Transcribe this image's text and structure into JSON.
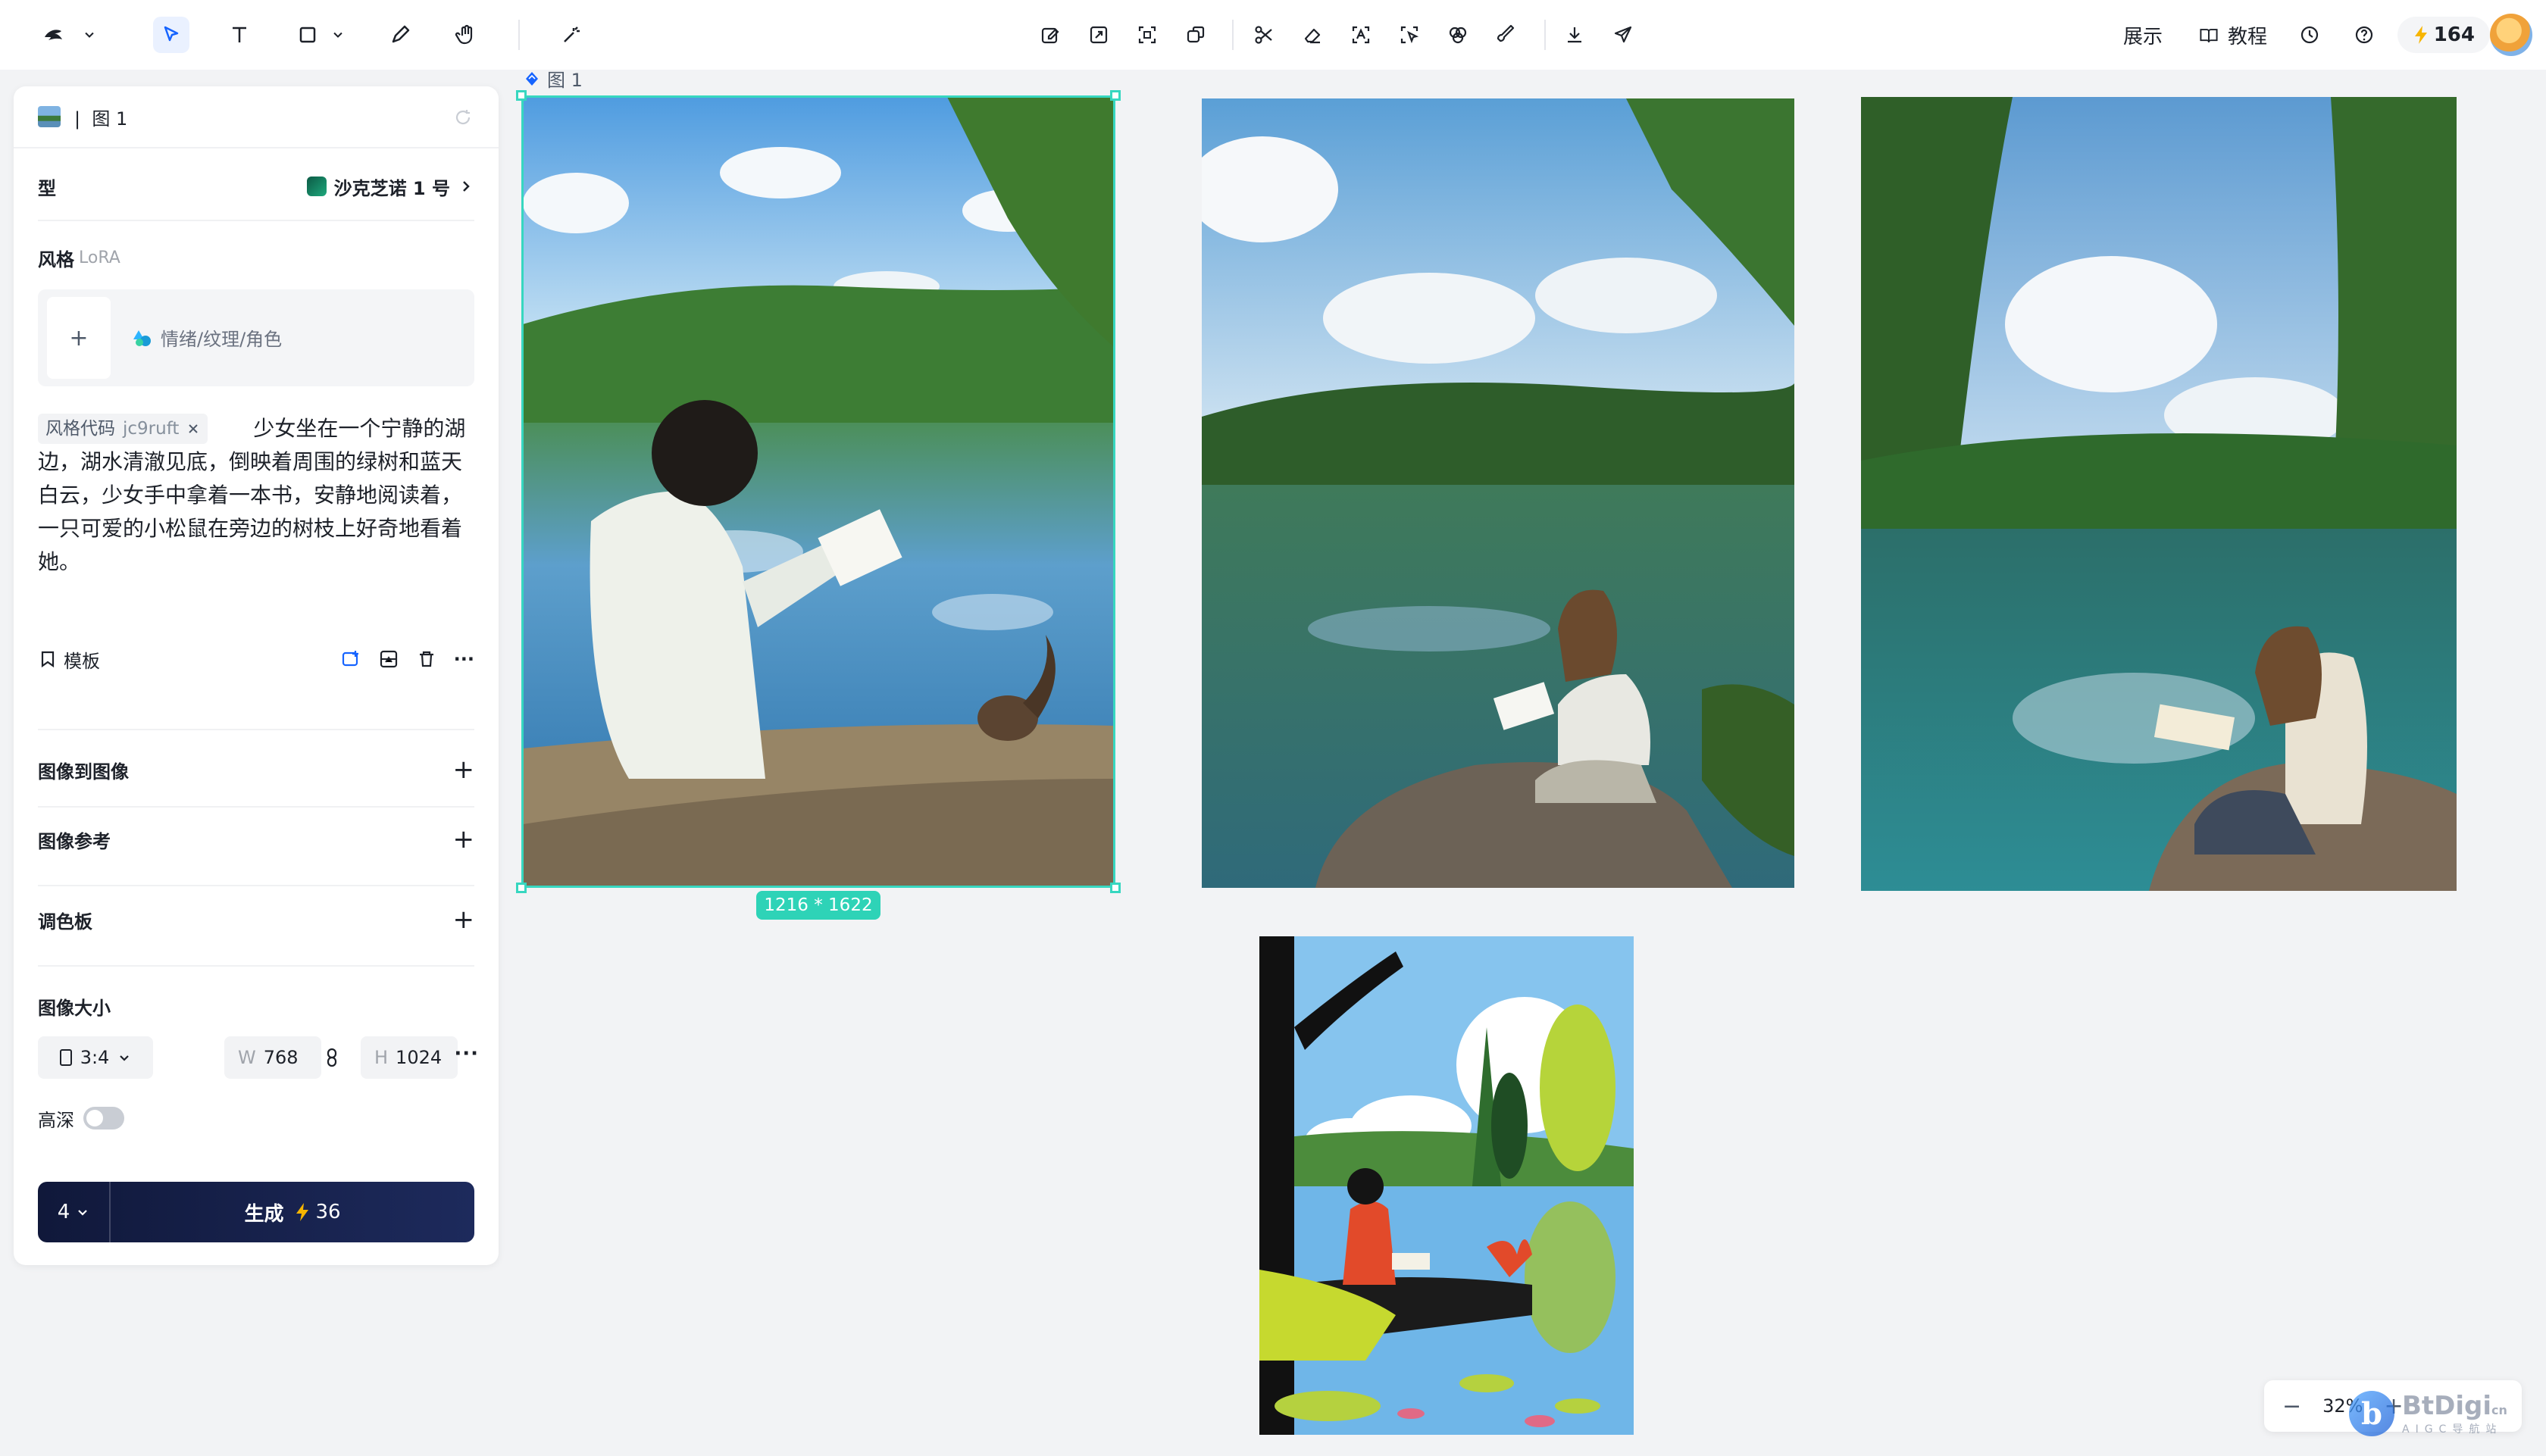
{
  "toolbar": {
    "show_label": "展示",
    "tutorial_label": "教程",
    "credits": "164"
  },
  "panel": {
    "title": "图 1",
    "model_label": "型",
    "model_value": "沙克芝诺 1 号",
    "style_label": "风格",
    "style_sub": "LoRA",
    "lora_hint": "情绪/纹理/角色",
    "style_code_label": "风格代码",
    "style_code_value": "jc9ruft",
    "prompt": "少女坐在一个宁静的湖边，湖水清澈见底，倒映着周围的绿树和蓝天白云，少女手中拿着一本书，安静地阅读着，一只可爱的小松鼠在旁边的树枝上好奇地看着她。",
    "template_label": "模板",
    "img2img_label": "图像到图像",
    "img_ref_label": "图像参考",
    "palette_label": "调色板",
    "size_label": "图像大小",
    "ratio": "3:4",
    "width_key": "W",
    "width": "768",
    "height_key": "H",
    "height": "1024",
    "hd_label": "高深",
    "batch_count": "4",
    "generate_label": "生成",
    "generate_cost": "36"
  },
  "canvas": {
    "image_label": "图 1",
    "image_size": "1216 * 1622"
  },
  "zoom": {
    "level": "32%"
  },
  "watermark": {
    "brand": "BtDigi",
    "domain": "cn",
    "tagline": "AIGC导航站"
  },
  "colors": {
    "accent": "#1664ff",
    "selection": "#37d7c0",
    "generate_bg": "#10183a"
  }
}
